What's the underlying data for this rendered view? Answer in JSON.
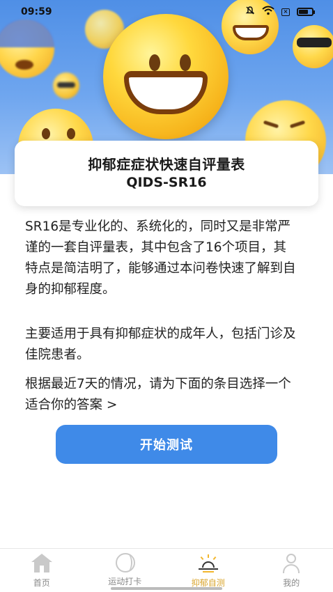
{
  "status_bar": {
    "time": "09:59"
  },
  "title_card": {
    "title": "抑郁症症状快速自评量表",
    "subtitle": "QIDS-SR16"
  },
  "description": {
    "paragraph1": "SR16是专业化的、系统化的，同时又是非常严谨的一套自评量表，其中包含了16个项目，其特点是简洁明了，能够通过本问卷快速了解到自身的抑郁程度。",
    "paragraph2": "主要适用于具有抑郁症状的成年人，包括门诊及佳院患者。",
    "paragraph3": "根据最近7天的情况，请为下面的条目选择一个适合你的答案 >"
  },
  "start_button": {
    "label": "开始测试",
    "color": "#3f8ae8"
  },
  "bottom_nav": {
    "items": [
      {
        "label": "首页",
        "icon": "home-icon",
        "active": false
      },
      {
        "label": "运动打卡",
        "icon": "ball-icon",
        "active": false
      },
      {
        "label": "抑郁自测",
        "icon": "sun-icon",
        "active": true
      },
      {
        "label": "我的",
        "icon": "person-icon",
        "active": false
      }
    ],
    "active_color": "#d9a42a"
  }
}
